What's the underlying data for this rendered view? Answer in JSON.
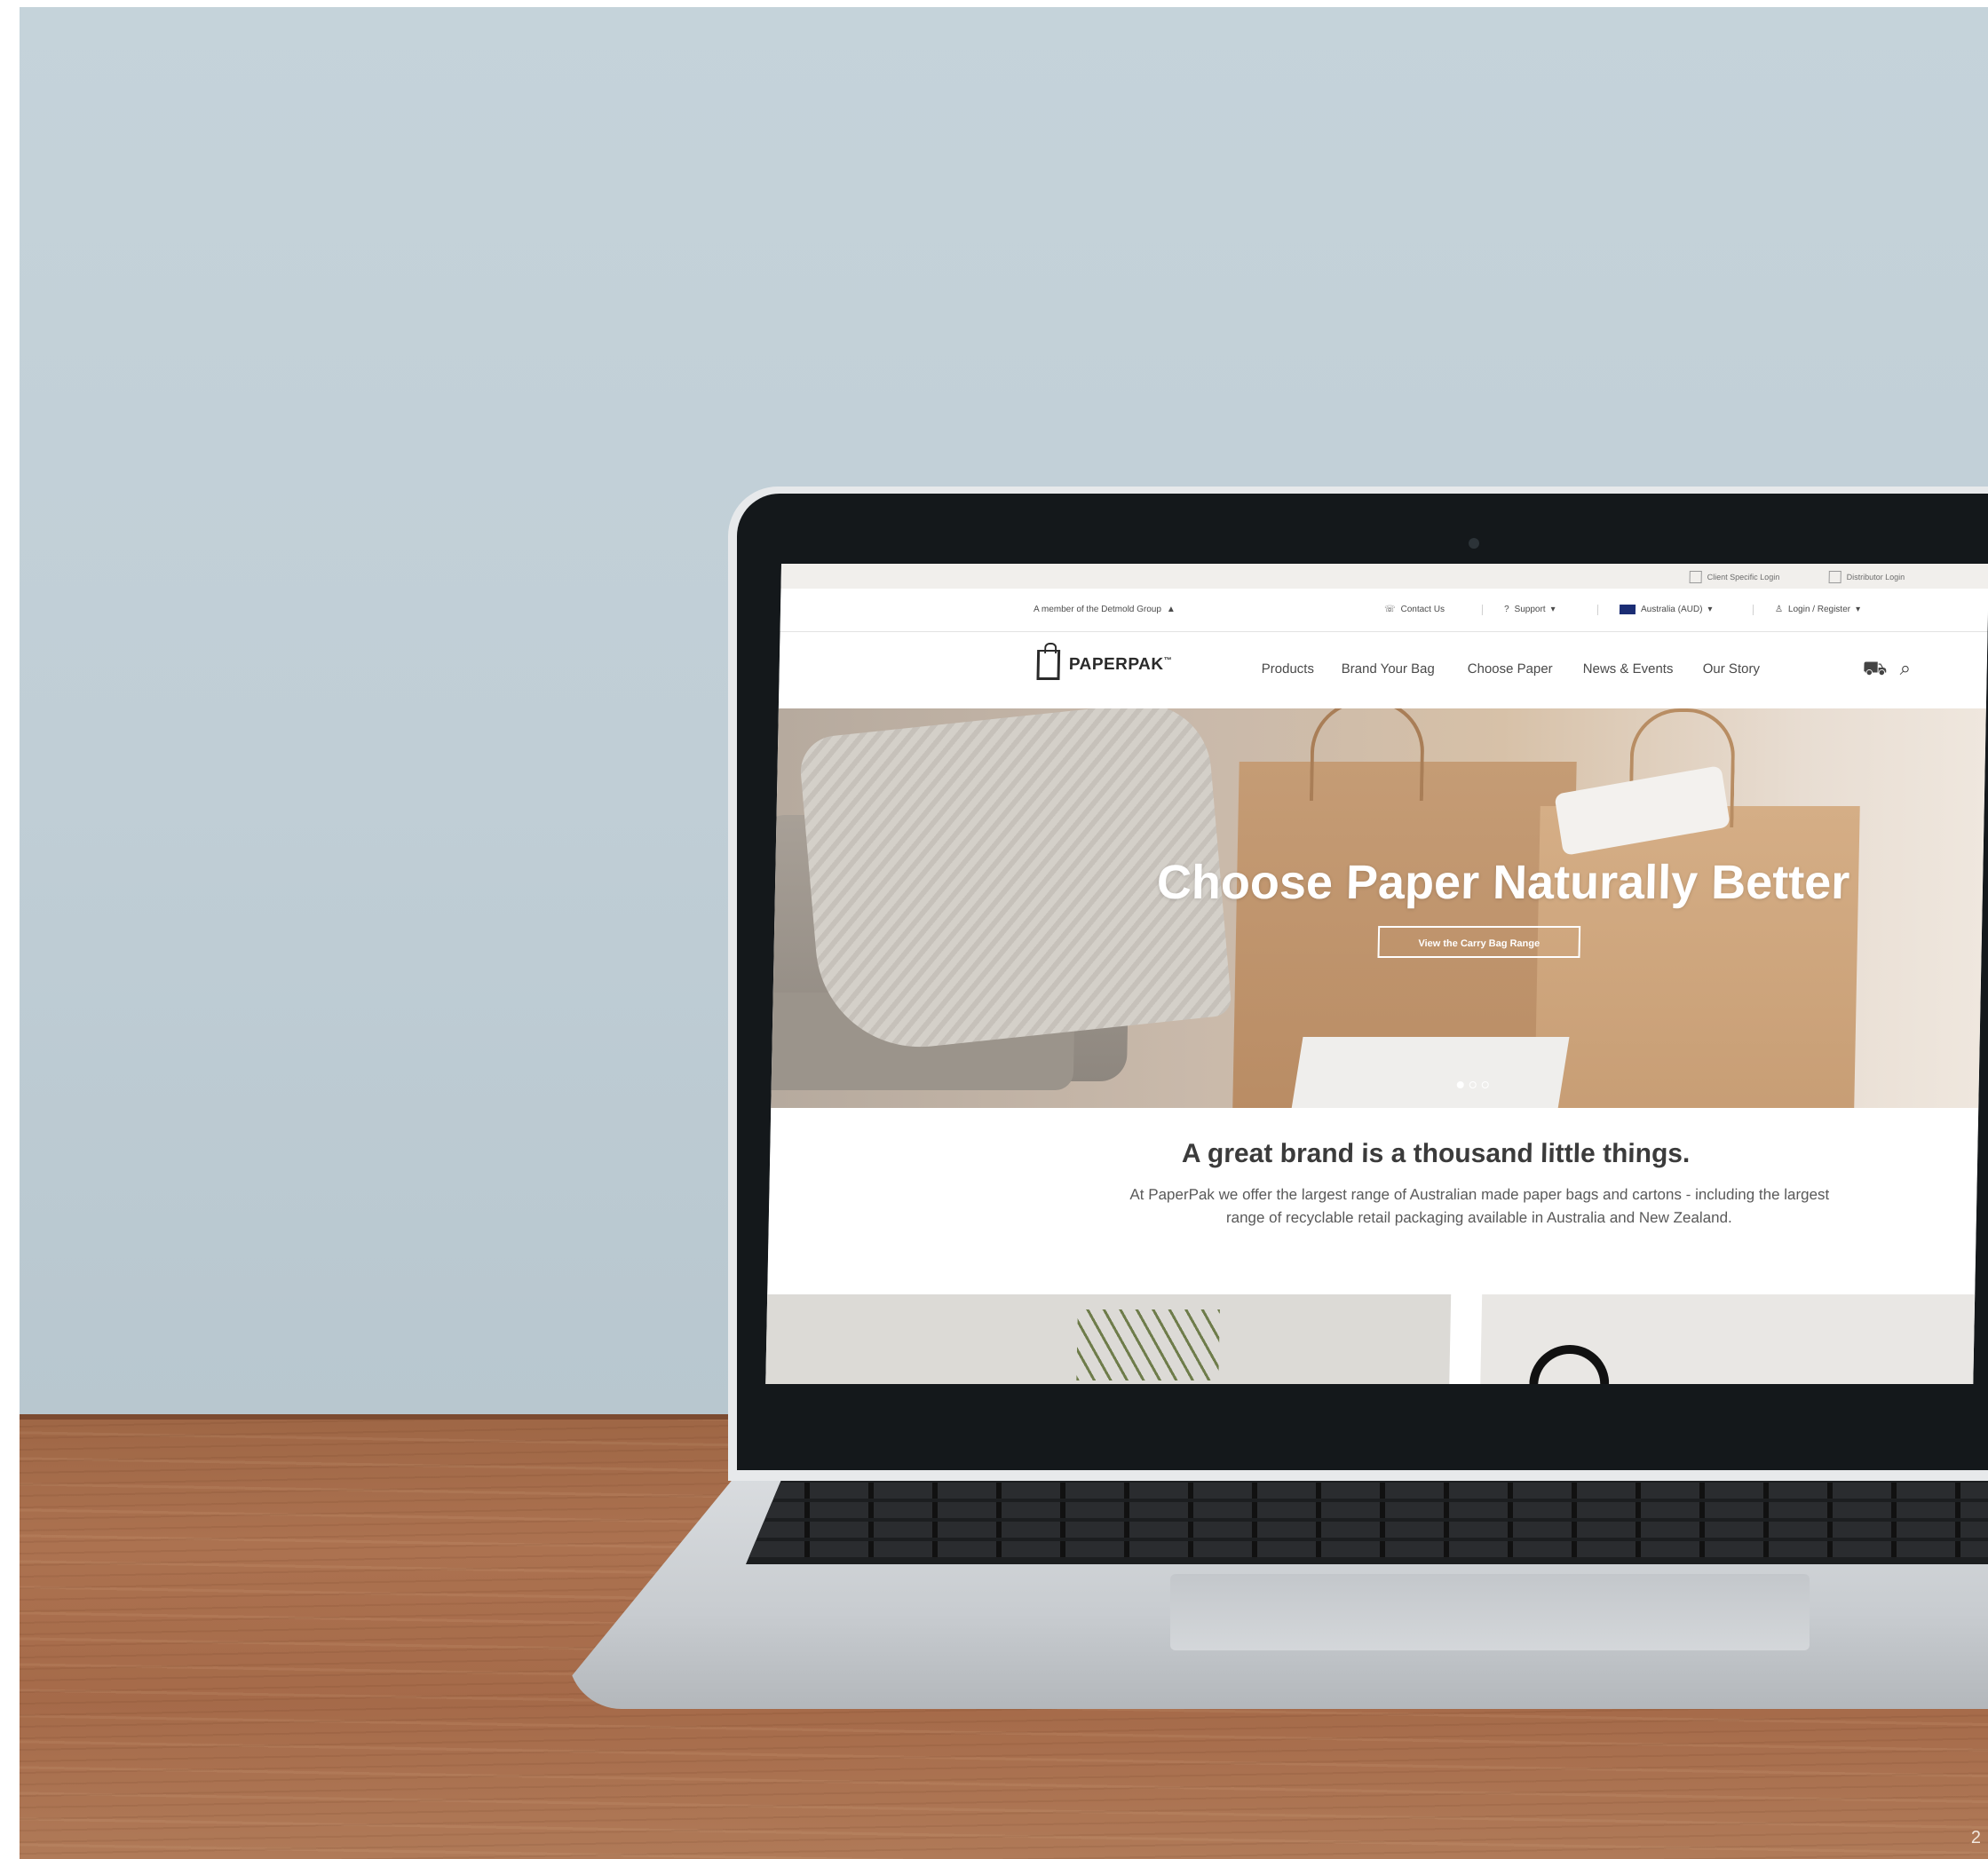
{
  "topbar": {
    "client_login": "Client Specific Login",
    "distributor_login": "Distributor Login"
  },
  "utility": {
    "member_text": "A member of the Detmold Group",
    "contact": "Contact Us",
    "support": "Support",
    "region": "Australia (AUD)",
    "login": "Login / Register"
  },
  "nav": {
    "logo": "PAPERPAK",
    "logo_tm": "™",
    "items": [
      "Products",
      "Brand Your Bag",
      "Choose Paper",
      "News & Events",
      "Our Story"
    ]
  },
  "hero": {
    "title": "Choose Paper Naturally Better",
    "button": "View the Carry Bag Range",
    "slides": 3,
    "active_slide": 1
  },
  "intro": {
    "title": "A great brand is a thousand little things.",
    "body": "At PaperPak we offer the largest range of Australian made paper bags and cartons - including the largest range of recyclable retail packaging available in Australia and New Zealand."
  },
  "page_number": "2"
}
